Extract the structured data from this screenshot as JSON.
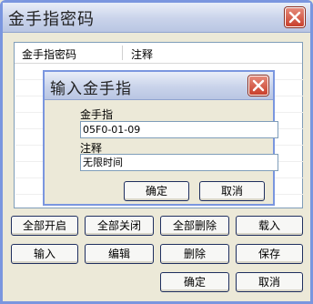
{
  "outer": {
    "title": "金手指密码",
    "list": {
      "columns": [
        "金手指密码",
        "注释"
      ]
    },
    "buttons": {
      "enable_all": "全部开启",
      "disable_all": "全部关闭",
      "delete_all": "全部删除",
      "load": "载入",
      "input": "输入",
      "edit": "编辑",
      "delete": "删除",
      "save": "保存",
      "ok": "确定",
      "cancel": "取消"
    }
  },
  "inner": {
    "title": "输入金手指",
    "code_label": "金手指",
    "code_value": "05F0-01-09",
    "note_label": "注释",
    "note_value": "无限时间",
    "ok": "确定",
    "cancel": "取消"
  },
  "icons": {
    "close": "close-icon"
  },
  "colors": {
    "close_button": "#c9402c",
    "titlebar": "#c9d3ea",
    "window_bg": "#ece9d8"
  }
}
